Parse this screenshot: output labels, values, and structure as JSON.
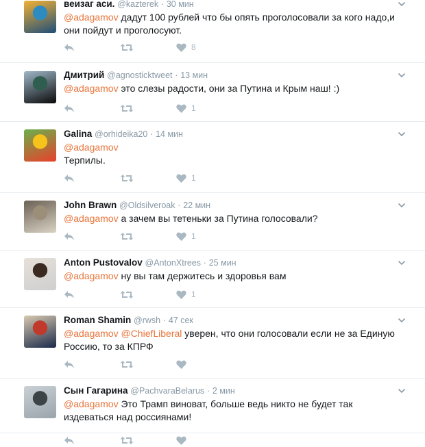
{
  "tweets": [
    {
      "name": "веизаг аси.",
      "handle": "@kazterek",
      "sep": "·",
      "time": "30 мин",
      "segments": [
        {
          "text": "@adagamov",
          "mention": true
        },
        {
          "text": " дадут 100 рублей что бы опять проголосовали за кого надо,и они пойдут и проголосуют.",
          "mention": false
        }
      ],
      "likes": "8",
      "avatar_colors": [
        "#1f4e79",
        "#2e8bc0",
        "#f2b134"
      ]
    },
    {
      "name": "Дмитрий",
      "handle": "@agnosticktweet",
      "sep": "·",
      "time": "13 мин",
      "segments": [
        {
          "text": "@adagamov",
          "mention": true
        },
        {
          "text": " это слезы радости, они за Путина и Крым наш! :)",
          "mention": false
        }
      ],
      "likes": "1",
      "avatar_colors": [
        "#0a0a0a",
        "#2f5d4f",
        "#9fb8c8"
      ]
    },
    {
      "name": "Galina",
      "handle": "@orhideika20",
      "sep": "·",
      "time": "14 мин",
      "segments": [
        {
          "text": "@adagamov",
          "mention": true
        },
        {
          "text": "\nТерпилы.",
          "mention": false
        }
      ],
      "likes": "1",
      "avatar_colors": [
        "#e8412c",
        "#f6c21c",
        "#6ab04c"
      ]
    },
    {
      "name": "John Brawn",
      "handle": "@Oldsilveroak",
      "sep": "·",
      "time": "22 мин",
      "segments": [
        {
          "text": "@adagamov",
          "mention": true
        },
        {
          "text": " а зачем вы тетеньки за Путина голосовали?",
          "mention": false
        }
      ],
      "likes": "1",
      "avatar_colors": [
        "#d9d2c5",
        "#9c8f7a",
        "#6b6154"
      ]
    },
    {
      "name": "Anton Pustovalov",
      "handle": "@AntonXtrees",
      "sep": "·",
      "time": "25 мин",
      "segments": [
        {
          "text": "@adagamov",
          "mention": true
        },
        {
          "text": " ну вы там держитесь и здоровья вам",
          "mention": false
        }
      ],
      "likes": "1",
      "avatar_colors": [
        "#cfcfcf",
        "#3a2a20",
        "#e6e0d8"
      ]
    },
    {
      "name": "Roman Shamin",
      "handle": "@rwsh",
      "sep": "·",
      "time": "47 сек",
      "segments": [
        {
          "text": "@adagamov",
          "mention": true
        },
        {
          "text": " ",
          "mention": false
        },
        {
          "text": "@ChiefLiberal",
          "mention": true
        },
        {
          "text": " уверен, что они голосовали если не за Единую Россию, то за КПРФ",
          "mention": false
        }
      ],
      "likes": "",
      "avatar_colors": [
        "#1b2a4a",
        "#c0392b",
        "#d8c9b0"
      ]
    },
    {
      "name": "Сын Гагарина",
      "handle": "@PachvaraBelarus",
      "sep": "·",
      "time": "2 мин",
      "segments": [
        {
          "text": "@adagamov",
          "mention": true
        },
        {
          "text": " Это Трамп виноват, больше ведь никто не будет так издеваться над россиянами!",
          "mention": false
        }
      ],
      "likes": "",
      "avatar_colors": [
        "#9aa4ab",
        "#3d4448",
        "#c9d1d6"
      ]
    }
  ],
  "icons": {
    "reply": "reply-icon",
    "retweet": "retweet-icon",
    "like": "heart-icon",
    "more": "chevron-down-icon"
  },
  "colors": {
    "mention": "#e8743a",
    "meta": "#8899a6",
    "action": "#aab8c2",
    "divider": "#e6ecf0"
  }
}
